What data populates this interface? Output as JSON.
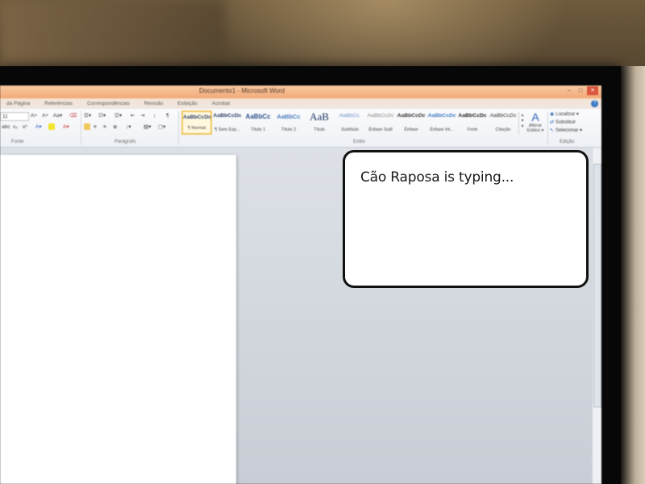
{
  "window": {
    "title": "Documento1 - Microsoft Word",
    "controls": {
      "minimize": "–",
      "maximize": "□",
      "close": "✕"
    }
  },
  "menu": {
    "tabs": [
      "da Página",
      "Referências",
      "Correspondências",
      "Revisão",
      "Exibição",
      "Acrobat"
    ],
    "help": "?"
  },
  "ribbon": {
    "font_size": "11",
    "groups": {
      "font": "Fonte",
      "paragraph": "Parágrafo",
      "styles": "Estilo",
      "editing": "Edição"
    },
    "styles": [
      {
        "sample": "AaBbCcDc",
        "name": "¶ Normal",
        "selected": true
      },
      {
        "sample": "AaBbCcDc",
        "name": "¶ Sem Esp..."
      },
      {
        "sample": "AaBbCc",
        "name": "Título 1"
      },
      {
        "sample": "AaBbCc",
        "name": "Título 2"
      },
      {
        "sample": "AaB",
        "name": "Título"
      },
      {
        "sample": "AaBbCc.",
        "name": "Subtítulo"
      },
      {
        "sample": "AaBbCcDc",
        "name": "Ênfase Sutil"
      },
      {
        "sample": "AaBbCcDc",
        "name": "Ênfase"
      },
      {
        "sample": "AaBbCcDc",
        "name": "Ênfase Int..."
      },
      {
        "sample": "AaBbCcDc",
        "name": "Forte"
      },
      {
        "sample": "AaBbCcDc",
        "name": "Citação"
      }
    ],
    "change_styles": {
      "label1": "Alterar",
      "label2": "Estilos ▾"
    },
    "editing": {
      "find": "Localizar ▾",
      "replace": "Substituir",
      "select": "Selecionar ▾"
    }
  },
  "chat": {
    "status": "Cão Raposa is typing..."
  },
  "colors": {
    "titlebar": "#f2a977",
    "accent": "#2a63b8",
    "selected_style": "#f0c75c"
  }
}
